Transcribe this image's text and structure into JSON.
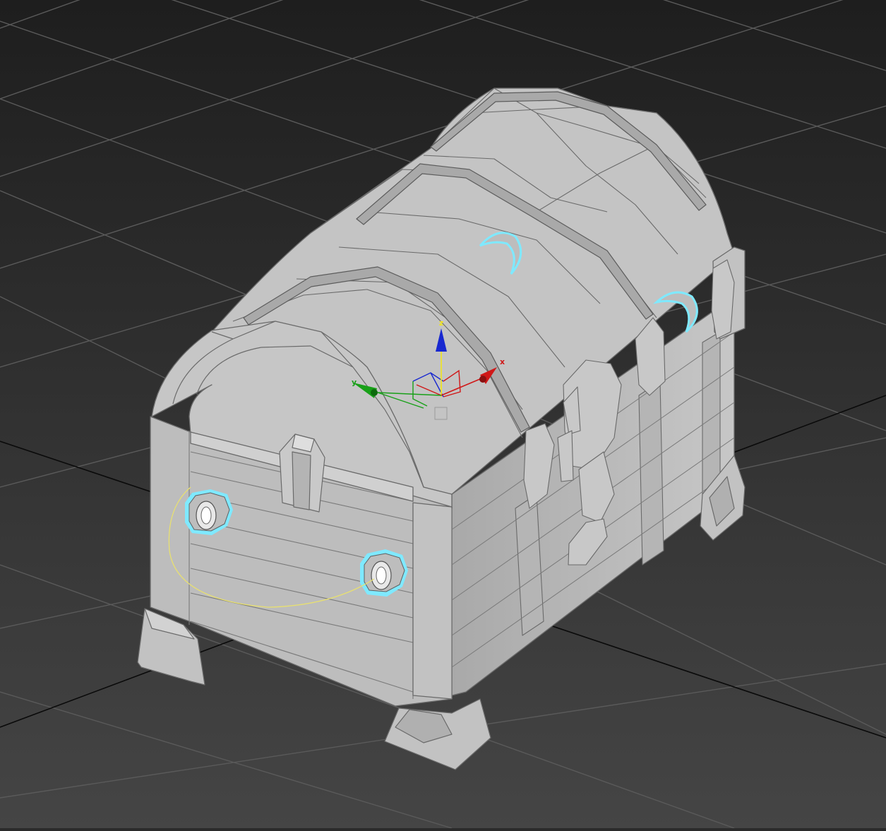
{
  "viewport": {
    "background_top": "#1e1e1e",
    "background_bottom": "#454545",
    "grid_color": "#5a5a5a",
    "grid_axis_color": "#0a0a0a"
  },
  "model": {
    "name": "treasure-chest",
    "surface_color": "#bdbdbd",
    "edge_color": "#6a6a6a",
    "selection_color": "#7fe9ff"
  },
  "gizmo": {
    "x_label": "x",
    "y_label": "y",
    "z_label": "z",
    "x_color": "#d01818",
    "y_color": "#18a018",
    "z_color": "#1828d0",
    "plane_color": "#f2e61a"
  },
  "pivot_orbit_color": "#e8e070"
}
